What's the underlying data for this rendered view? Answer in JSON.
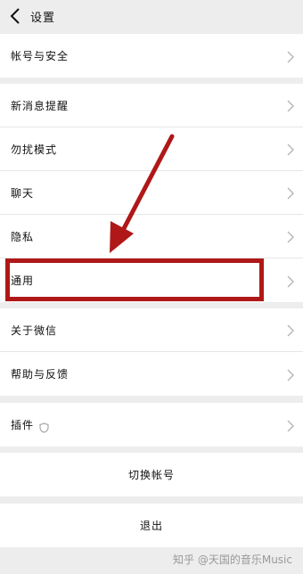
{
  "header": {
    "title": "设置"
  },
  "group1": [
    {
      "label": "帐号与安全"
    }
  ],
  "group2": [
    {
      "label": "新消息提醒"
    },
    {
      "label": "勿扰模式"
    },
    {
      "label": "聊天"
    },
    {
      "label": "隐私"
    },
    {
      "label": "通用"
    }
  ],
  "group3": [
    {
      "label": "关于微信"
    },
    {
      "label": "帮助与反馈"
    }
  ],
  "group4": [
    {
      "label": "插件"
    }
  ],
  "buttons": {
    "switch_account": "切换帐号",
    "logout": "退出"
  },
  "watermark": "知乎 @天国的音乐Music",
  "colors": {
    "background": "#ededed",
    "annotation": "#b01818"
  },
  "icons": {
    "back": "chevron-left-icon",
    "row_arrow": "chevron-right-icon",
    "plugin": "shield-icon"
  }
}
